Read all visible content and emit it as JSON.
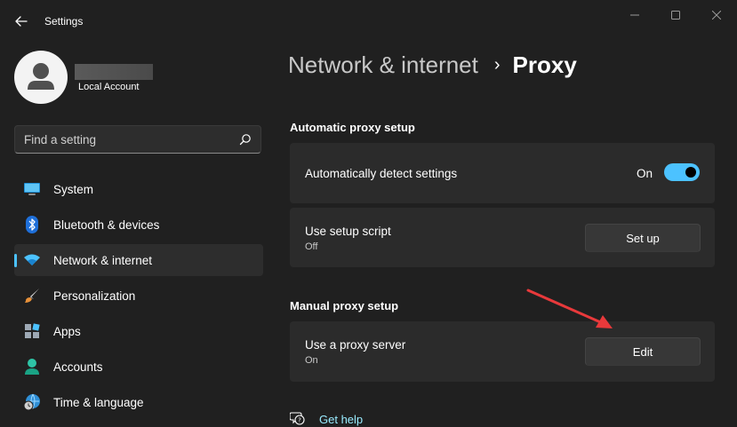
{
  "window": {
    "title": "Settings",
    "controls": [
      "minimize-icon",
      "maximize-icon",
      "close-icon"
    ]
  },
  "profile": {
    "account_type": "Local Account"
  },
  "search": {
    "placeholder": "Find a setting"
  },
  "sidebar": {
    "items": [
      {
        "label": "System",
        "icon": "system-icon",
        "active": false
      },
      {
        "label": "Bluetooth & devices",
        "icon": "bluetooth-icon",
        "active": false
      },
      {
        "label": "Network & internet",
        "icon": "wifi-icon",
        "active": true
      },
      {
        "label": "Personalization",
        "icon": "brush-icon",
        "active": false
      },
      {
        "label": "Apps",
        "icon": "apps-icon",
        "active": false
      },
      {
        "label": "Accounts",
        "icon": "accounts-icon",
        "active": false
      },
      {
        "label": "Time & language",
        "icon": "time-language-icon",
        "active": false
      }
    ]
  },
  "header": {
    "parent": "Network & internet",
    "separator": "›",
    "current": "Proxy"
  },
  "automatic": {
    "section_title": "Automatic proxy setup",
    "detect": {
      "label": "Automatically detect settings",
      "state_label": "On",
      "enabled": true
    },
    "script": {
      "label": "Use setup script",
      "status": "Off",
      "button": "Set up"
    }
  },
  "manual": {
    "section_title": "Manual proxy setup",
    "proxy_server": {
      "label": "Use a proxy server",
      "status": "On",
      "button": "Edit"
    }
  },
  "help": {
    "label": "Get help"
  },
  "colors": {
    "accent": "#4cc2ff",
    "background": "#202020",
    "card": "#2b2b2b",
    "annotation_arrow": "#e8393b"
  }
}
